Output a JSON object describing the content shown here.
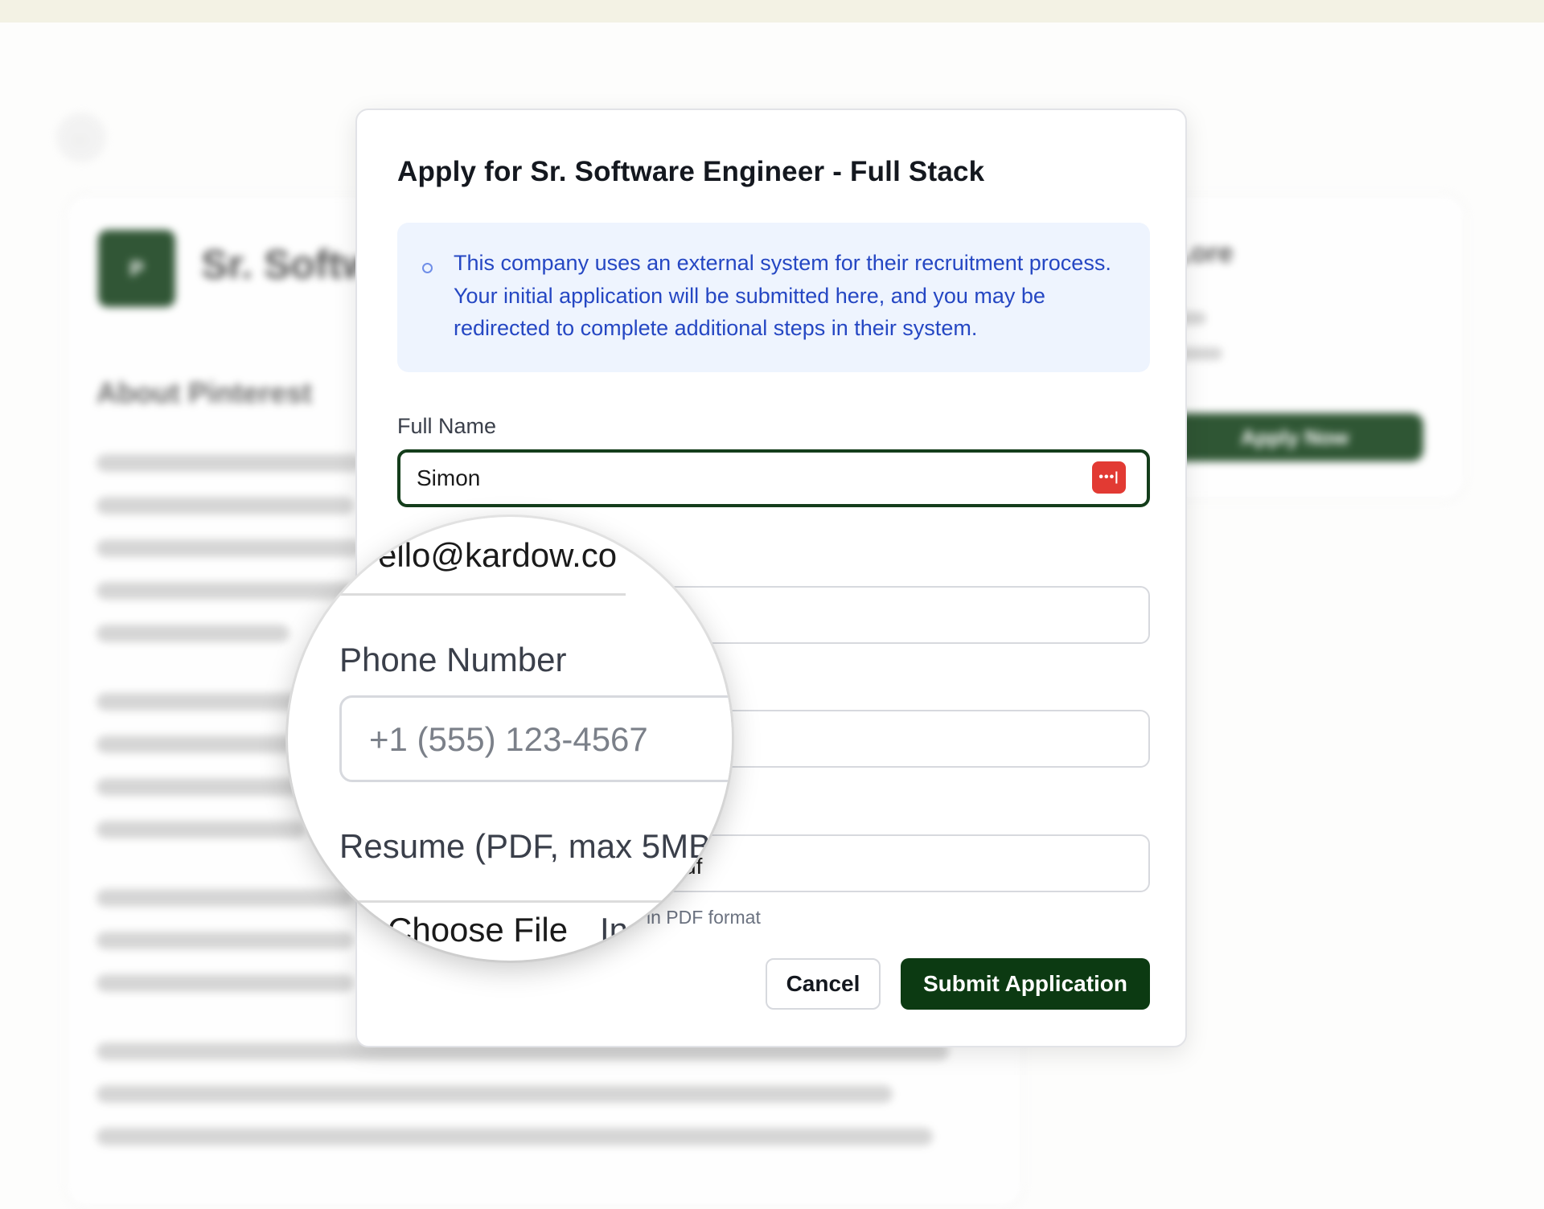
{
  "background_page": {
    "logo_letter": "P",
    "job_title": "Sr. Softw",
    "about_heading": "About Pinterest",
    "side_title": "Lore",
    "apply_now_label": "Apply Now",
    "back_icon": "arrow-left-icon"
  },
  "modal": {
    "title": "Apply for Sr. Software Engineer - Full Stack",
    "info_icon": "info-circle-icon",
    "info_text": "This company uses an external system for their recruitment process. Your initial application will be submitted here, and you may be redirected to complete additional steps in their system.",
    "full_name": {
      "label": "Full Name",
      "value": "Simon",
      "password_manager_icon": "password-manager-icon",
      "password_manager_glyph": "•••|"
    },
    "email": {
      "value_partial": "ello@kardow.co"
    },
    "phone": {
      "label": "Phone Number",
      "placeholder": "+1 (555) 123-4567"
    },
    "resume": {
      "label": "Resume (PDF, max 5MB)",
      "file_name_partial": "df",
      "choose_file_label": "Choose File",
      "choose_file_status_partial": "In",
      "help_text_partial": "in PDF format"
    },
    "buttons": {
      "cancel": "Cancel",
      "submit": "Submit Application"
    }
  },
  "colors": {
    "primary_dark_green": "#0c3a12",
    "info_bg": "#eef4fe",
    "info_text": "#2547c3",
    "password_manager_red": "#e23a33"
  }
}
